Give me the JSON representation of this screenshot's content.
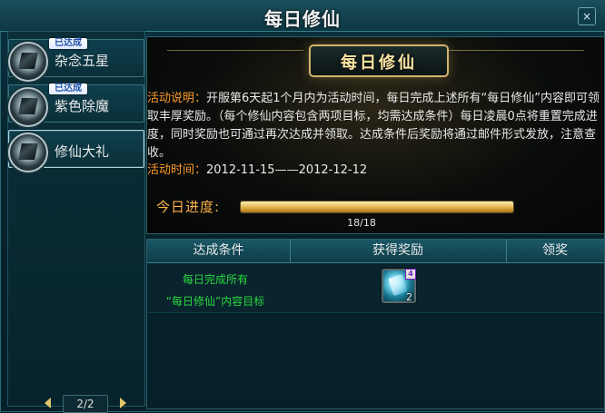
{
  "window": {
    "title": "每日修仙",
    "close_label": "×"
  },
  "sidebar": {
    "items": [
      {
        "label": "杂念五星",
        "badge": "已达成"
      },
      {
        "label": "紫色除魔",
        "badge": "已达成"
      },
      {
        "label": "修仙大礼",
        "badge": ""
      }
    ],
    "pager": {
      "text": "2/2"
    }
  },
  "activity": {
    "banner": "每日修仙",
    "desc_label": "活动说明：",
    "desc_text": "开服第6天起1个月内为活动时间，每日完成上述所有“每日修仙”内容即可领取丰厚奖励。（每个修仙内容包含两项目标，均需达成条件）每日凌晨0点将重置完成进度，同时奖励也可通过再次达成并领取。达成条件后奖励将通过邮件形式发放，注意查收。",
    "time_label": "活动时间：",
    "time_value": "2012-11-15——2012-12-12"
  },
  "progress": {
    "label": "今日进度:",
    "text": "18/18",
    "value": 1.0
  },
  "table": {
    "headers": [
      "达成条件",
      "获得奖励",
      "领奖"
    ],
    "row": {
      "condition_line1": "每日完成所有",
      "condition_line2": "“每日修仙”内容目标",
      "reward": {
        "icon": "blue-crystal-icon",
        "tag": "4",
        "count": "2"
      }
    }
  }
}
